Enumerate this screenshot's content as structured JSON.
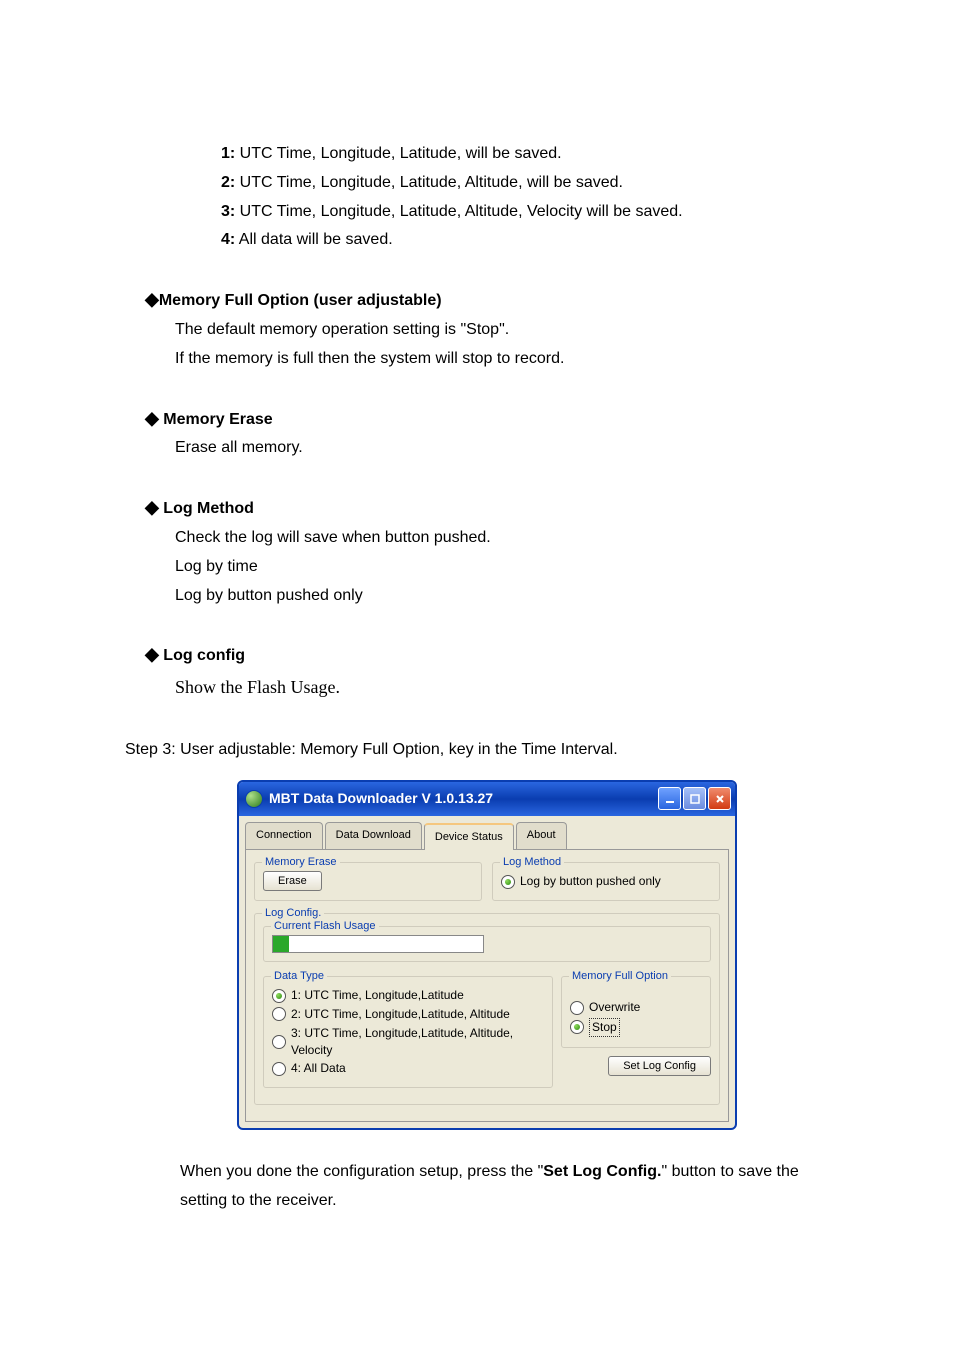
{
  "legend": {
    "items": [
      {
        "num": "1:",
        "text": " UTC Time, Longitude, Latitude, will be saved."
      },
      {
        "num": "2:",
        "text": " UTC Time, Longitude, Latitude, Altitude, will be saved."
      },
      {
        "num": "3:",
        "text": " UTC Time, Longitude, Latitude, Altitude, Velocity will be saved."
      },
      {
        "num": "4:",
        "text": " All data will be saved."
      }
    ]
  },
  "sections": {
    "memfull": {
      "head": "Memory Full Option (user adjustable)",
      "p1": "The default memory operation setting is \"Stop\".",
      "p2": "If the memory is full then the system will stop to record."
    },
    "memerase": {
      "head": " Memory Erase",
      "p1": "Erase all memory."
    },
    "logmethod": {
      "head": " Log Method",
      "p1": "Check the log will save when button pushed.",
      "p2": "Log by time",
      "p3": "Log by button pushed only"
    },
    "logconfig": {
      "head": " Log config",
      "p1": "Show the Flash Usage."
    }
  },
  "step3": "Step 3: User adjustable: Memory Full Option, key in the Time Interval.",
  "after": {
    "pre": "When you done the configuration setup, press the \"",
    "bold": "Set Log Config.",
    "post": "\" button to save the setting to the receiver."
  },
  "window": {
    "title": "MBT Data Downloader V 1.0.13.27",
    "tabs": {
      "connection": "Connection",
      "dataDownload": "Data Download",
      "deviceStatus": "Device Status",
      "about": "About"
    },
    "memoryErase": {
      "legend": "Memory Erase",
      "button": "Erase"
    },
    "logMethod": {
      "legend": "Log Method",
      "radio": "Log by button pushed only"
    },
    "logConfig": {
      "legend": "Log Config.",
      "flashLegend": "Current Flash Usage"
    },
    "dataType": {
      "legend": "Data Type",
      "opt1": "1: UTC Time, Longitude,Latitude",
      "opt2": "2: UTC Time, Longitude,Latitude, Altitude",
      "opt3": "3: UTC Time, Longitude,Latitude, Altitude, Velocity",
      "opt4": "4: All Data"
    },
    "memoryFullOption": {
      "legend": "Memory Full Option",
      "overwrite": "Overwrite",
      "stop": "Stop"
    },
    "setLogConfig": "Set Log Config"
  }
}
